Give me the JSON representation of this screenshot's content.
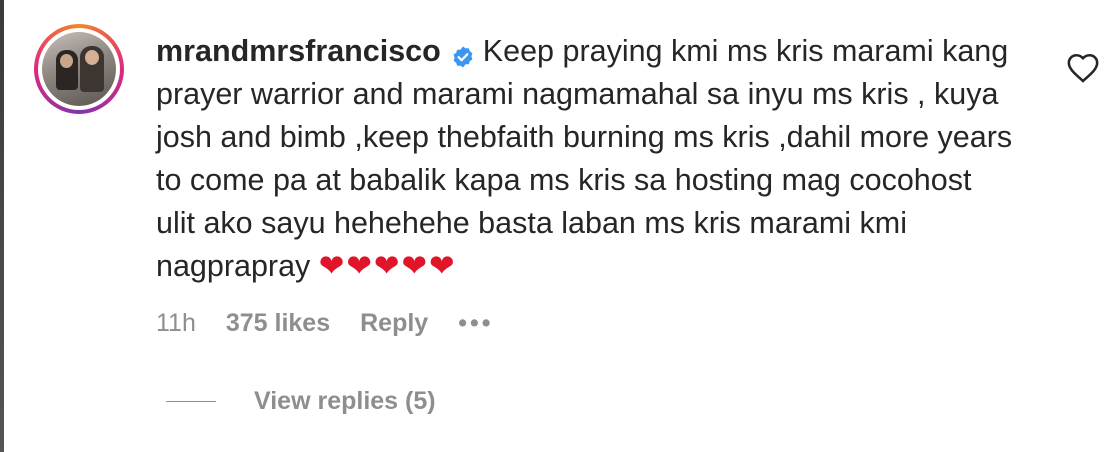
{
  "comment": {
    "username": "mrandmrsfrancisco",
    "verified_icon": "verified-badge-icon",
    "text": "Keep praying kmi ms kris marami kang prayer warrior and marami nagmamahal sa inyu ms kris , kuya josh and bimb ,keep thebfaith burning ms kris ,dahil more years to come pa at babalik kapa ms kris sa hosting mag cocohost ulit ako sayu hehehehe basta laban ms kris marami kmi nagprapray",
    "hearts": "❤❤❤❤❤",
    "like_icon": "heart-outline-icon"
  },
  "meta": {
    "time": "11h",
    "likes": "375 likes",
    "reply_label": "Reply",
    "more_label": "•••"
  },
  "replies": {
    "view_label": "View replies (5)"
  },
  "colors": {
    "text": "#262626",
    "secondary": "#8e8e8e",
    "verified": "#3897f0",
    "heart": "#e0152a"
  }
}
